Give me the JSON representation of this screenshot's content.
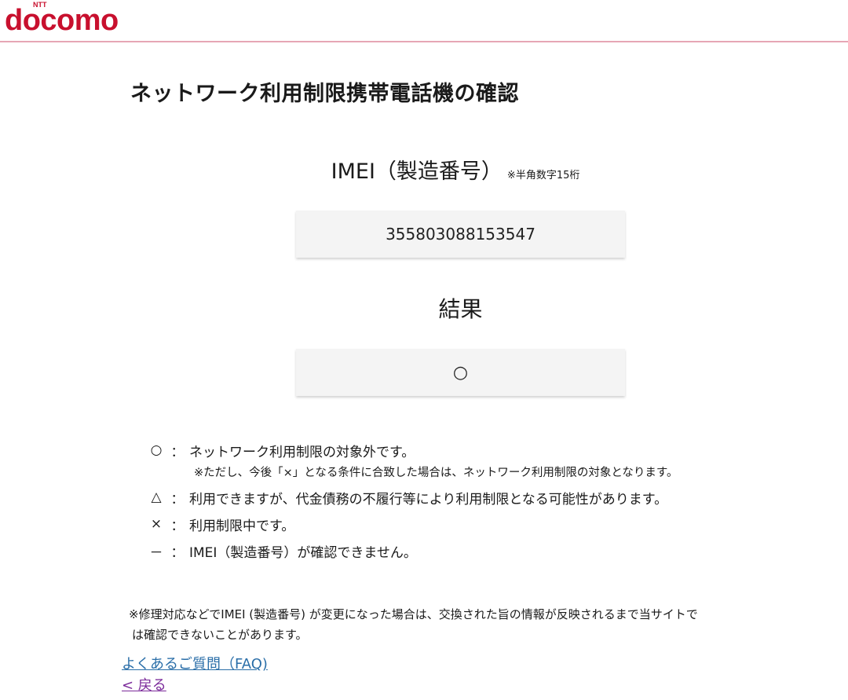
{
  "header": {
    "logo_small": "NTT",
    "logo_main": "docomo",
    "brand_color": "#c8102e"
  },
  "page_title": "ネットワーク利用制限携帯電話機の確認",
  "imei": {
    "heading": "IMEI（製造番号）",
    "note": "※半角数字15桁",
    "value": "355803088153547"
  },
  "result": {
    "heading": "結果",
    "value": "○"
  },
  "legend": [
    {
      "symbol": "○",
      "colon": "：",
      "text": "ネットワーク利用制限の対象外です。"
    },
    {
      "symbol": "△",
      "colon": "：",
      "text": "利用できますが、代金債務の不履行等により利用制限となる可能性があります。"
    },
    {
      "symbol": "×",
      "colon": "：",
      "text": "利用制限中です。"
    },
    {
      "symbol": "－",
      "colon": "：",
      "text": "IMEI（製造番号）が確認できません。"
    }
  ],
  "legend_note": "※ただし、今後「×」となる条件に合致した場合は、ネットワーク利用制限の対象となります。",
  "footnote": {
    "line1": "※修理対応などでIMEI (製造番号) が変更になった場合は、交換された旨の情報が反映されるまで当サイトで",
    "line2": "は確認できないことがあります。"
  },
  "links": {
    "faq": "よくあるご質問（FAQ)",
    "back": "< 戻る"
  }
}
